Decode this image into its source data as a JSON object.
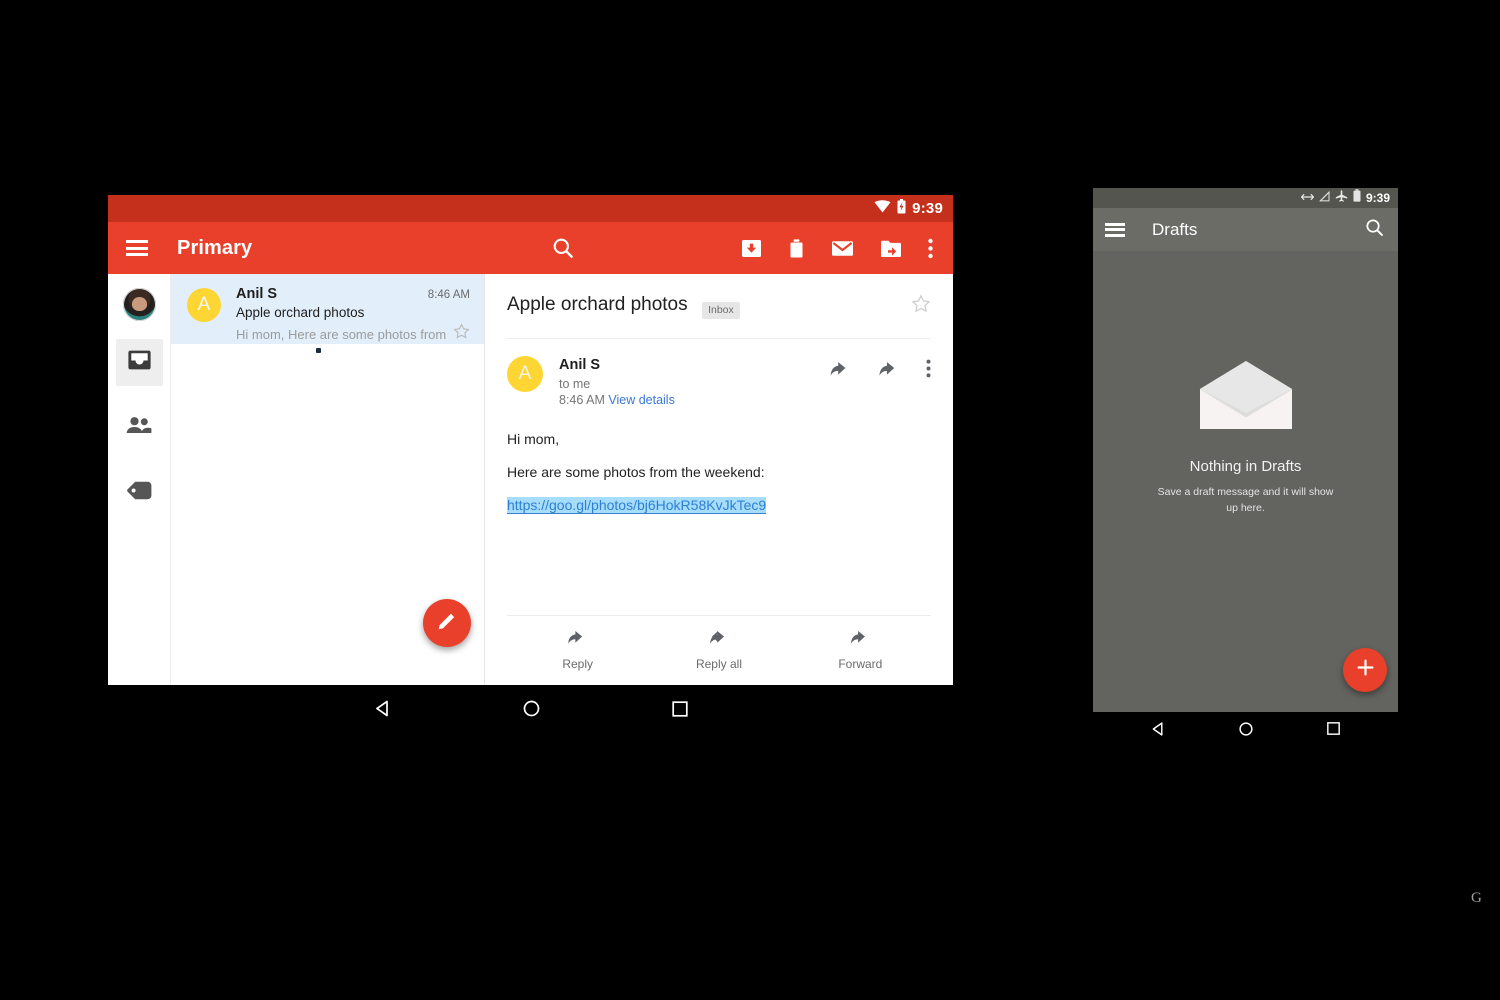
{
  "tablet": {
    "status_bar": {
      "clock": "9:39",
      "icons": [
        "wifi-icon",
        "battery-charging-icon"
      ]
    },
    "appbar": {
      "menu_icon": "hamburger-menu-icon",
      "title": "Primary",
      "search_icon": "search-icon",
      "actions": [
        "archive-icon",
        "delete-icon",
        "mark-unread-icon",
        "move-to-folder-icon",
        "overflow-menu-icon"
      ]
    },
    "rail": {
      "avatar": "account-avatar",
      "items": [
        {
          "icon": "inbox-icon",
          "selected": true
        },
        {
          "icon": "people-icon",
          "selected": false
        },
        {
          "icon": "label-tag-icon",
          "selected": false
        }
      ]
    },
    "list": {
      "rows": [
        {
          "avatar_letter": "A",
          "sender": "Anil S",
          "time": "8:46 AM",
          "subject": "Apple orchard photos",
          "snippet": "Hi mom, Here are some photos from t…",
          "star_icon": "star-outline-icon",
          "selected": true
        }
      ]
    },
    "detail": {
      "subject": "Apple orchard photos",
      "label_chip": "Inbox",
      "star_icon": "star-outline-icon",
      "sender_avatar_letter": "A",
      "sender_name": "Anil S",
      "recipient": "to me",
      "time": "8:46 AM",
      "view_details": "View details",
      "actions_icons": [
        "reply-icon",
        "forward-icon",
        "overflow-menu-icon"
      ],
      "body": [
        "Hi mom,",
        "Here are some photos from the weekend:"
      ],
      "link": "https://goo.gl/photos/bj6HokR58KvJkTec9",
      "footer_actions": [
        {
          "label": "Reply",
          "icon": "reply-icon"
        },
        {
          "label": "Reply all",
          "icon": "reply-all-icon"
        },
        {
          "label": "Forward",
          "icon": "forward-icon"
        }
      ]
    },
    "fab": {
      "icon": "compose-pencil-icon",
      "color": "#e8402a"
    },
    "nav_bar": [
      "back-triangle-icon",
      "home-circle-icon",
      "recents-square-icon"
    ]
  },
  "phone": {
    "status_bar": {
      "clock": "9:39",
      "icons": [
        "usb-debug-icon",
        "no-signal-icon",
        "airplane-mode-icon",
        "battery-icon"
      ]
    },
    "appbar": {
      "menu_icon": "hamburger-menu-icon",
      "title": "Drafts",
      "search_icon": "search-icon"
    },
    "empty_state": {
      "illustration": "open-envelope-icon",
      "title": "Nothing in Drafts",
      "subtitle": "Save a draft message and it will show up here."
    },
    "fab": {
      "icon": "plus-icon",
      "color": "#e8402a"
    },
    "nav_bar": [
      "back-triangle-icon",
      "home-circle-icon",
      "recents-square-icon"
    ]
  },
  "watermark": {
    "text": "G"
  },
  "colors": {
    "appbar_red": "#e8402a",
    "status_red": "#c4301b",
    "selected_row_blue": "#e2effa",
    "avatar_yellow": "#fdd633",
    "link_blue": "#2f7fd4",
    "link_highlight": "#a5ddfa",
    "phone_gray": "#63645f",
    "phone_appbar_gray": "#6b6c66"
  }
}
